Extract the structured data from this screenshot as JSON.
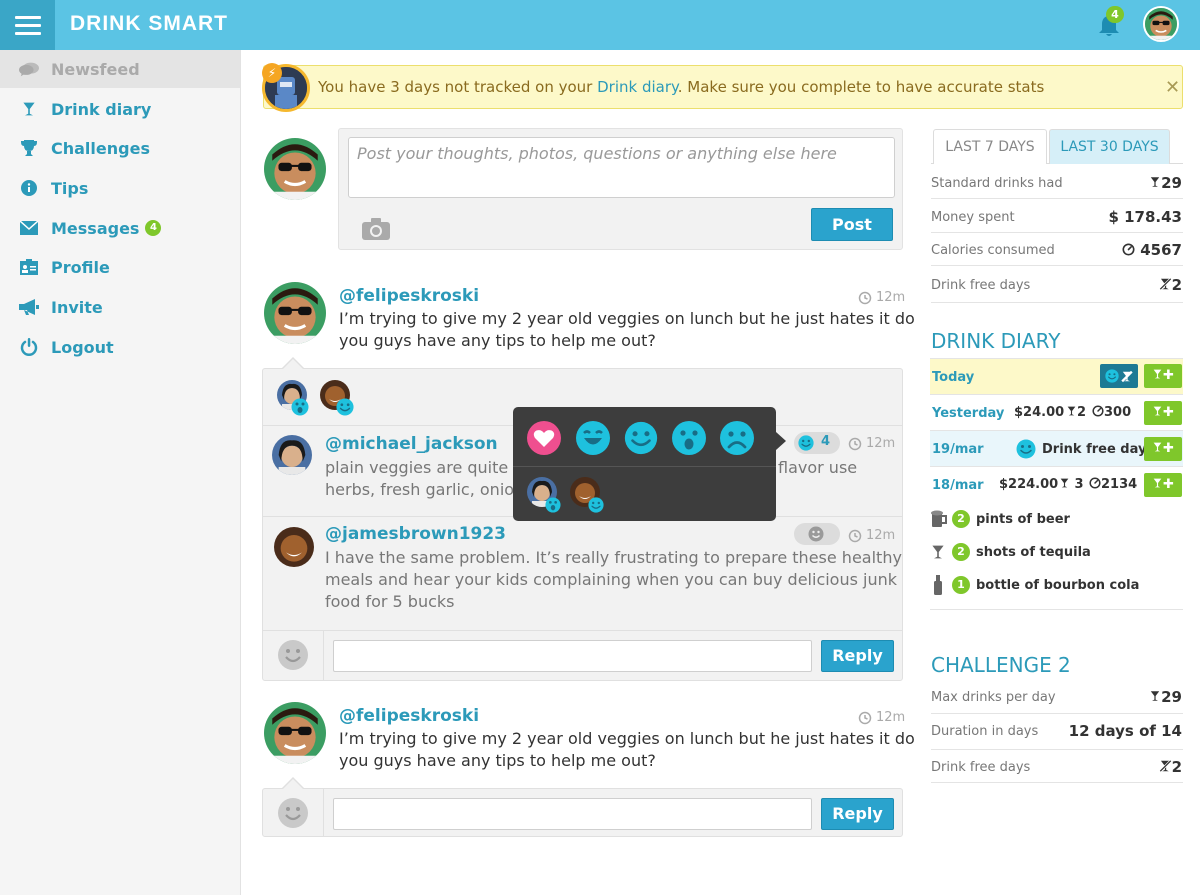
{
  "app": {
    "title": "DRINK SMART",
    "notification_count": "4"
  },
  "nav": {
    "items": [
      {
        "label": "Newsfeed"
      },
      {
        "label": "Drink diary"
      },
      {
        "label": "Challenges"
      },
      {
        "label": "Tips"
      },
      {
        "label": "Messages",
        "badge": "4"
      },
      {
        "label": "Profile"
      },
      {
        "label": "Invite"
      },
      {
        "label": "Logout"
      }
    ]
  },
  "alert": {
    "text_before": "You have 3 days not tracked on your ",
    "link": "Drink diary",
    "text_after": ". Make sure you complete to have accurate stats"
  },
  "composer": {
    "placeholder": "Post your thoughts, photos, questions or anything else here",
    "button": "Post"
  },
  "posts": [
    {
      "user": "@felipeskroski",
      "time": "12m",
      "line1": "I’m trying to give my 2 year old veggies on lunch but he just hates it do",
      "line2": "you guys have any tips to help me out?"
    },
    {
      "user": "@felipeskroski",
      "time": "12m",
      "line1": "I’m trying to give my 2 year old veggies on lunch but he just hates it do",
      "line2": "you guys have any tips to help me out?"
    }
  ],
  "comments": [
    {
      "user": "@michael_jackson",
      "time": "12m",
      "reaction_count": "4",
      "line1_left": "plain veggies are quite ha",
      "line1_right": "flavor use",
      "line2": "herbs, fresh garlic, onion"
    },
    {
      "user": "@jamesbrown1923",
      "time": "12m",
      "line1": "I have the same problem. It’s really frustrating to prepare these healthy",
      "line2": "meals and hear your kids complaining when you can buy delicious junk",
      "line3": "food for 5 bucks"
    }
  ],
  "reply_button": "Reply",
  "stats": {
    "tabs": [
      "LAST 7 DAYS",
      "LAST 30 DAYS"
    ],
    "rows": [
      {
        "label": "Standard drinks had",
        "value": "29"
      },
      {
        "label": "Money spent",
        "value": "$ 178.43"
      },
      {
        "label": "Calories consumed",
        "value": "4567"
      },
      {
        "label": "Drink free days",
        "value": "2"
      }
    ]
  },
  "diary": {
    "title": "DRINK DIARY",
    "rows": [
      {
        "date": "Today"
      },
      {
        "date": "Yesterday",
        "money": "$24.00",
        "drinks": "2",
        "calories": "300"
      },
      {
        "date": "19/mar",
        "note": "Drink free day"
      },
      {
        "date": "18/mar",
        "money": "$224.00",
        "drinks": "3",
        "calories": "2134"
      }
    ],
    "items": [
      {
        "count": "2",
        "label": "pints of beer"
      },
      {
        "count": "2",
        "label": "shots of tequila"
      },
      {
        "count": "1",
        "label": "bottle of bourbon cola"
      }
    ]
  },
  "challenge": {
    "title": "CHALLENGE 2",
    "rows": [
      {
        "label": "Max drinks per day",
        "value": "29"
      },
      {
        "label": "Duration in days",
        "value": "12 days of 14"
      },
      {
        "label": "Drink free days",
        "value": "2"
      }
    ]
  },
  "colors": {
    "primary": "#5bc4e4",
    "accent": "#2c9ab9",
    "green": "#7fc72b",
    "reaction": "#1ec1de",
    "love": "#ef4f8f"
  }
}
